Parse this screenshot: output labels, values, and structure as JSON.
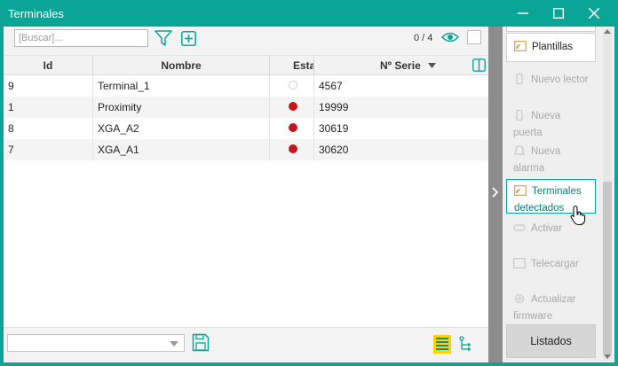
{
  "window": {
    "title": "Terminales",
    "accent": "#0aa596"
  },
  "toolbar": {
    "search_placeholder": "[Buscar]...",
    "filter_icon": "filter-icon",
    "add_icon": "add-icon",
    "count": "0 / 4",
    "eye_icon": "eye-icon"
  },
  "grid": {
    "columns": [
      "Id",
      "Nombre",
      "Esta",
      "Nº Serie"
    ],
    "sort_column": "Nº Serie",
    "rows": [
      {
        "id": "9",
        "nombre": "Terminal_1",
        "estado": "off",
        "serie": "4567"
      },
      {
        "id": "1",
        "nombre": "Proximity",
        "estado": "red",
        "serie": "19999"
      },
      {
        "id": "8",
        "nombre": "XGA_A2",
        "estado": "red",
        "serie": "30619"
      },
      {
        "id": "7",
        "nombre": "XGA_A1",
        "estado": "red",
        "serie": "30620"
      }
    ],
    "status_colors": {
      "red": "#c4161c",
      "off": "#ffffff"
    }
  },
  "sidebar": {
    "items": [
      {
        "label": "Plantillas",
        "state": "normal",
        "icon": "template-icon"
      },
      {
        "label": "Nuevo lector",
        "state": "disabled",
        "icon": "reader-icon"
      },
      {
        "label": "Nueva puerta",
        "state": "disabled",
        "icon": "door-icon"
      },
      {
        "label": "Nueva alarma",
        "state": "disabled",
        "icon": "bell-icon"
      },
      {
        "label": "Terminales detectados",
        "state": "active",
        "icon": "terminal-detect-icon"
      },
      {
        "label": "Activar",
        "state": "disabled",
        "icon": "activate-icon"
      },
      {
        "label": "Telecargar",
        "state": "disabled",
        "icon": "upload-icon"
      },
      {
        "label": "Actualizar firmware",
        "state": "disabled",
        "icon": "gear-icon"
      }
    ],
    "listados_label": "Listados"
  }
}
